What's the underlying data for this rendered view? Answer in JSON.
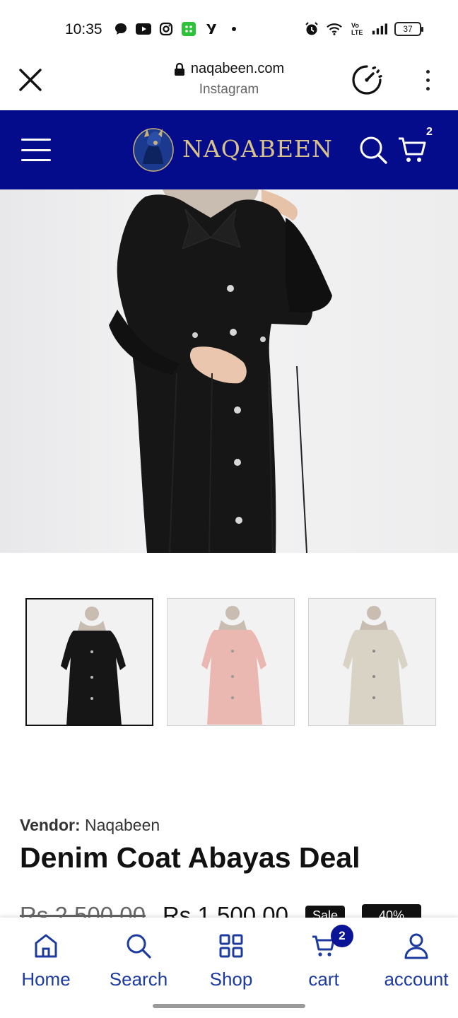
{
  "status_bar": {
    "time": "10:35",
    "battery": "37",
    "left_icons": [
      "chat-bubble-icon",
      "youtube-icon",
      "instagram-icon",
      "app-grid-icon",
      "y-app-icon",
      "dot-icon"
    ],
    "right_icons": [
      "alarm-icon",
      "wifi-icon",
      "volte-icon",
      "signal-icon",
      "battery-icon"
    ]
  },
  "browser": {
    "url": "naqabeen.com",
    "subtitle": "Instagram",
    "icons": [
      "close-icon",
      "lock-icon",
      "speed-icon",
      "more-vert-icon"
    ]
  },
  "site_header": {
    "brand": "NAQABEEN",
    "cart_count": "2",
    "bg_color": "#040c8c",
    "brand_color": "#d9c28a",
    "icons": [
      "menu-icon",
      "logo-emblem",
      "search-icon",
      "cart-icon"
    ]
  },
  "gallery": {
    "thumbnails": [
      {
        "color_name": "black",
        "color": "#151515",
        "selected": true
      },
      {
        "color_name": "pink",
        "color": "#eab8b1",
        "selected": false
      },
      {
        "color_name": "beige",
        "color": "#d9d3c5",
        "selected": false
      }
    ]
  },
  "product": {
    "vendor_label": "Vendor:",
    "vendor_name": "Naqabeen",
    "title": "Denim Coat Abayas Deal",
    "price_old": "Rs.2,500.00",
    "price_new": "Rs.1,500.00",
    "badge_sale": "Sale",
    "badge_off": "40%"
  },
  "bottom_nav": {
    "accent": "#1c3aa0",
    "items": [
      {
        "label": "Home",
        "icon": "home-icon"
      },
      {
        "label": "Search",
        "icon": "search-icon"
      },
      {
        "label": "Shop",
        "icon": "grid-icon"
      },
      {
        "label": "cart",
        "icon": "cart-icon",
        "badge": "2"
      },
      {
        "label": "account",
        "icon": "user-icon"
      }
    ]
  }
}
